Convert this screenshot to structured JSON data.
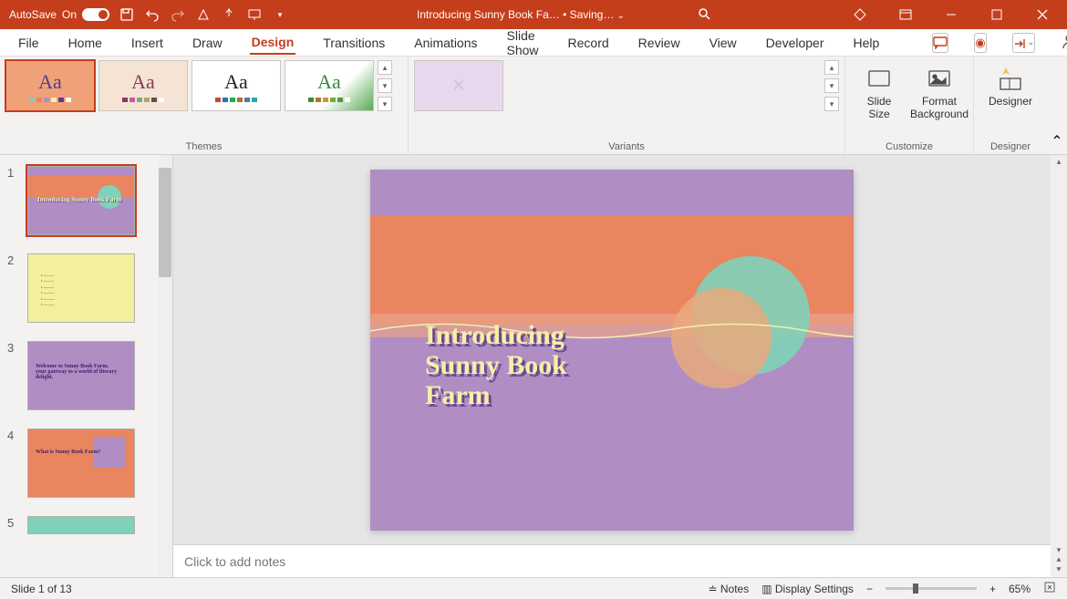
{
  "titlebar": {
    "autosave_label": "AutoSave",
    "autosave_state": "On",
    "doc_title": "Introducing Sunny Book Fa…",
    "save_state": "• Saving…"
  },
  "tabs": {
    "file": "File",
    "home": "Home",
    "insert": "Insert",
    "draw": "Draw",
    "design": "Design",
    "transitions": "Transitions",
    "animations": "Animations",
    "slideshow": "Slide Show",
    "record": "Record",
    "review": "Review",
    "view": "View",
    "developer": "Developer",
    "help": "Help"
  },
  "ribbon": {
    "themes_label": "Themes",
    "variants_label": "Variants",
    "customize_label": "Customize",
    "designer_label": "Designer",
    "slide_size": "Slide\nSize",
    "format_bg": "Format\nBackground",
    "designer_btn": "Designer"
  },
  "slide": {
    "title": "Introducing\nSunny Book\nFarm"
  },
  "thumbs": {
    "t1": "Introducing Sunny Book Farm",
    "t3": "Welcome to Sunny Book Farm, your gateway to a world of literary delight.",
    "t4": "What is Sunny Book Farm?"
  },
  "notes": {
    "placeholder": "Click to add notes"
  },
  "status": {
    "slide_count": "Slide 1 of 13",
    "notes": "Notes",
    "display": "Display Settings",
    "zoom": "65%"
  }
}
